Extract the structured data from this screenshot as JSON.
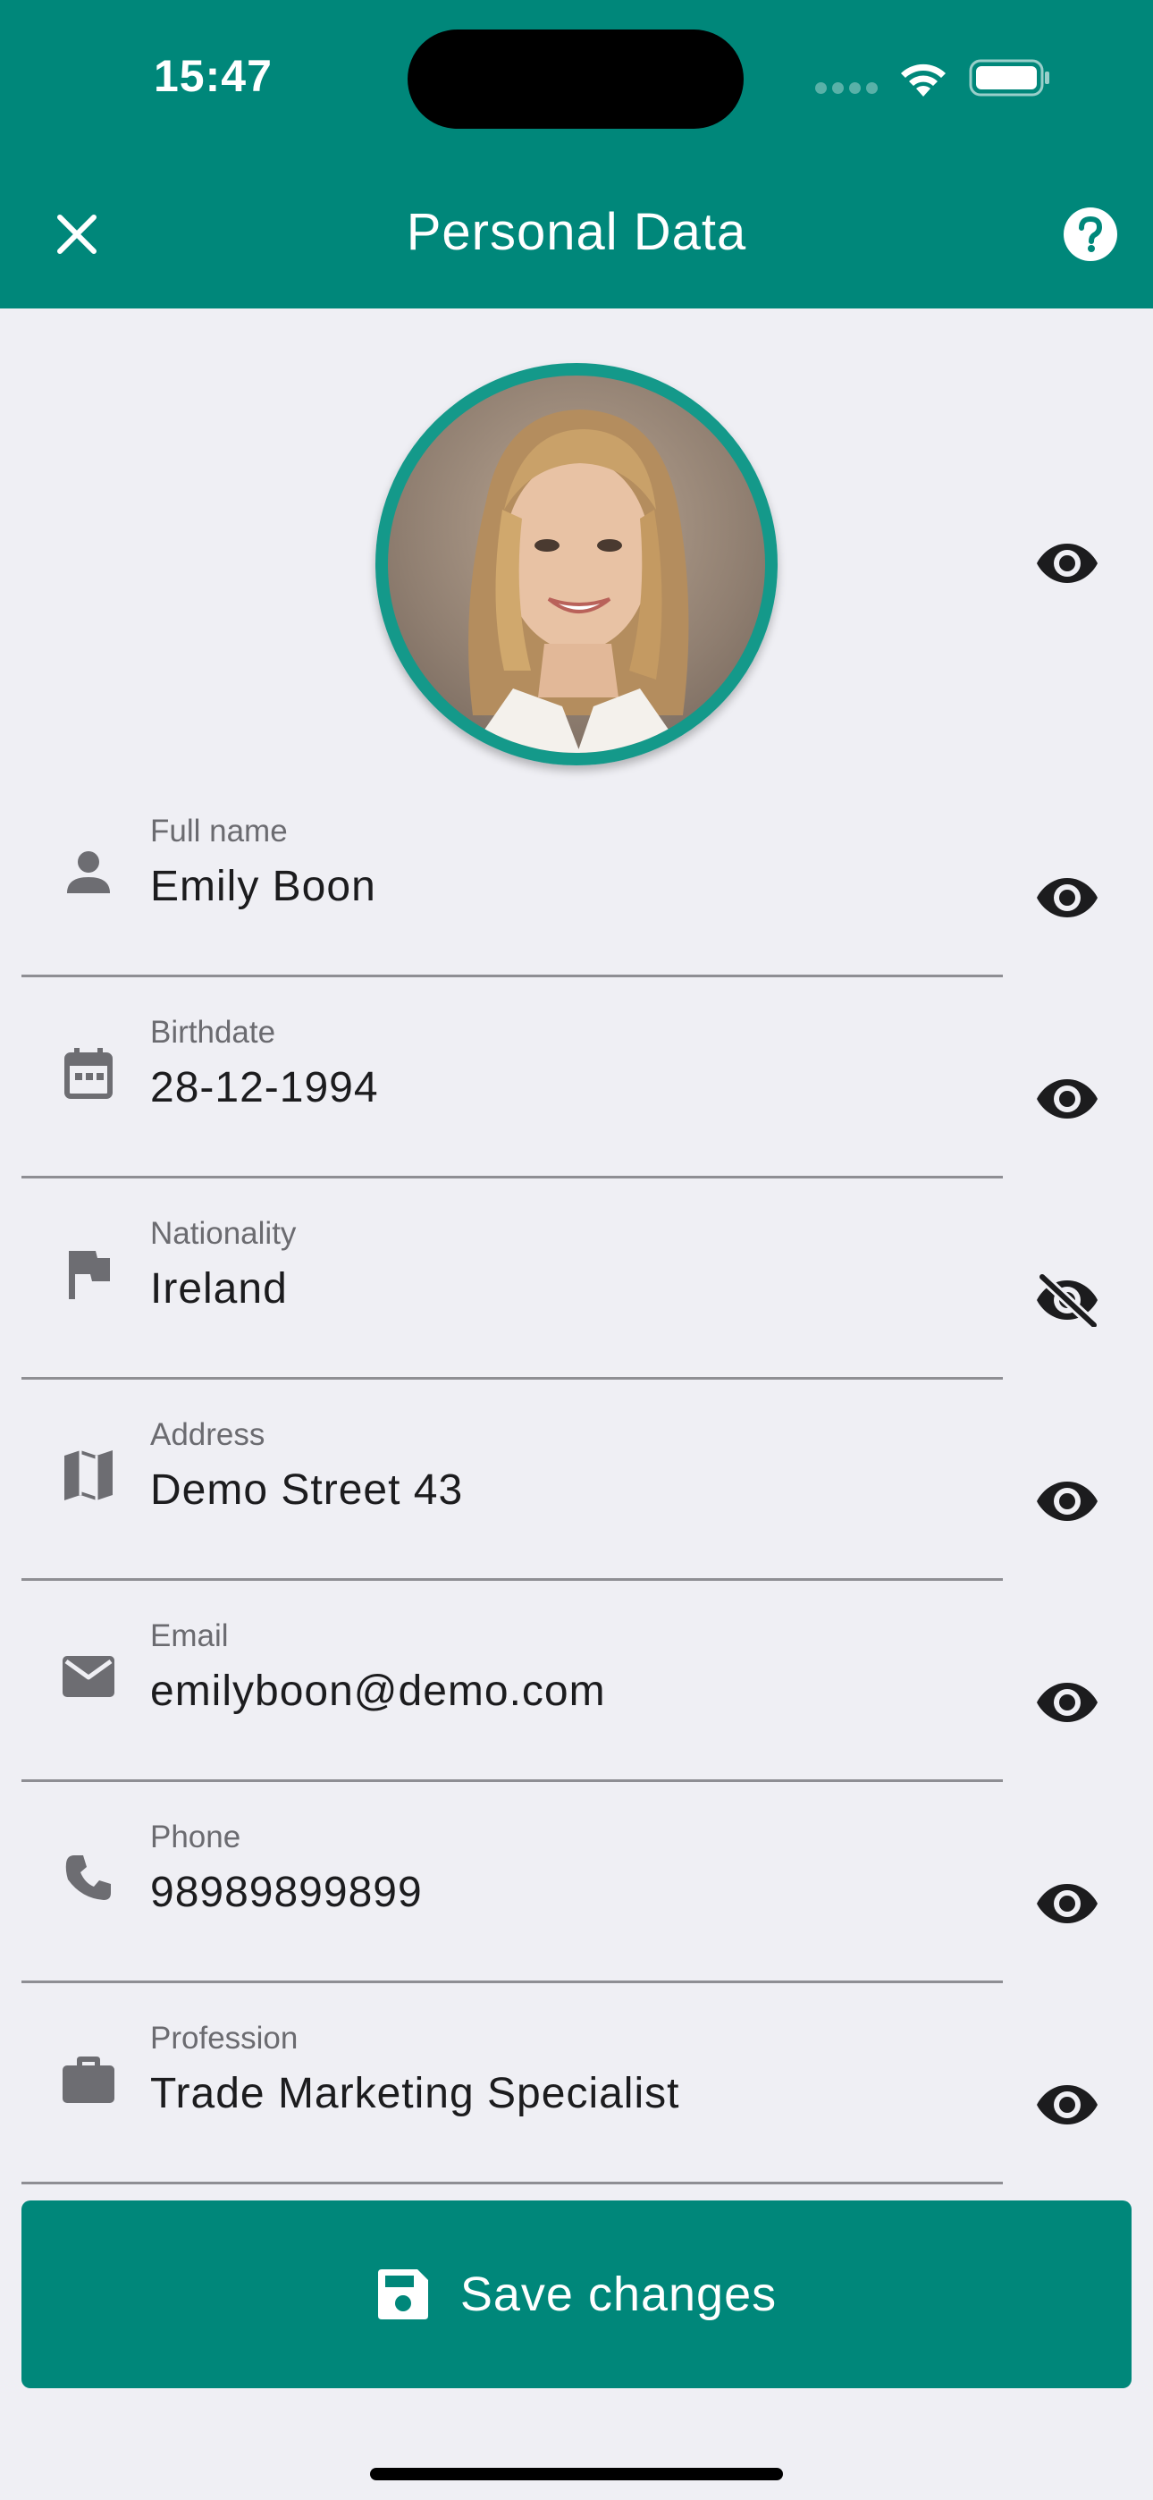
{
  "status_bar": {
    "time": "15:47"
  },
  "header": {
    "title": "Personal Data",
    "close_icon": "close-icon",
    "help_icon": "help-icon"
  },
  "avatar": {
    "visibility": "visible"
  },
  "fields": [
    {
      "label": "Full name",
      "value": "Emily Boon",
      "icon": "person-icon",
      "visibility": "visible"
    },
    {
      "label": "Birthdate",
      "value": "28-12-1994",
      "icon": "calendar-icon",
      "visibility": "visible"
    },
    {
      "label": "Nationality",
      "value": "Ireland",
      "icon": "flag-icon",
      "visibility": "hidden"
    },
    {
      "label": "Address",
      "value": "Demo Street 43",
      "icon": "map-icon",
      "visibility": "visible"
    },
    {
      "label": "Email",
      "value": "emilyboon@demo.com",
      "icon": "email-icon",
      "visibility": "visible"
    },
    {
      "label": "Phone",
      "value": "98989899899",
      "icon": "phone-icon",
      "visibility": "visible"
    },
    {
      "label": "Profession",
      "value": "Trade Marketing Specialist",
      "icon": "briefcase-icon",
      "visibility": "visible"
    }
  ],
  "save_button": {
    "label": "Save changes",
    "icon": "save-icon"
  },
  "colors": {
    "primary": "#00877a",
    "avatar_ring": "#14998a",
    "background": "#efeff4"
  }
}
